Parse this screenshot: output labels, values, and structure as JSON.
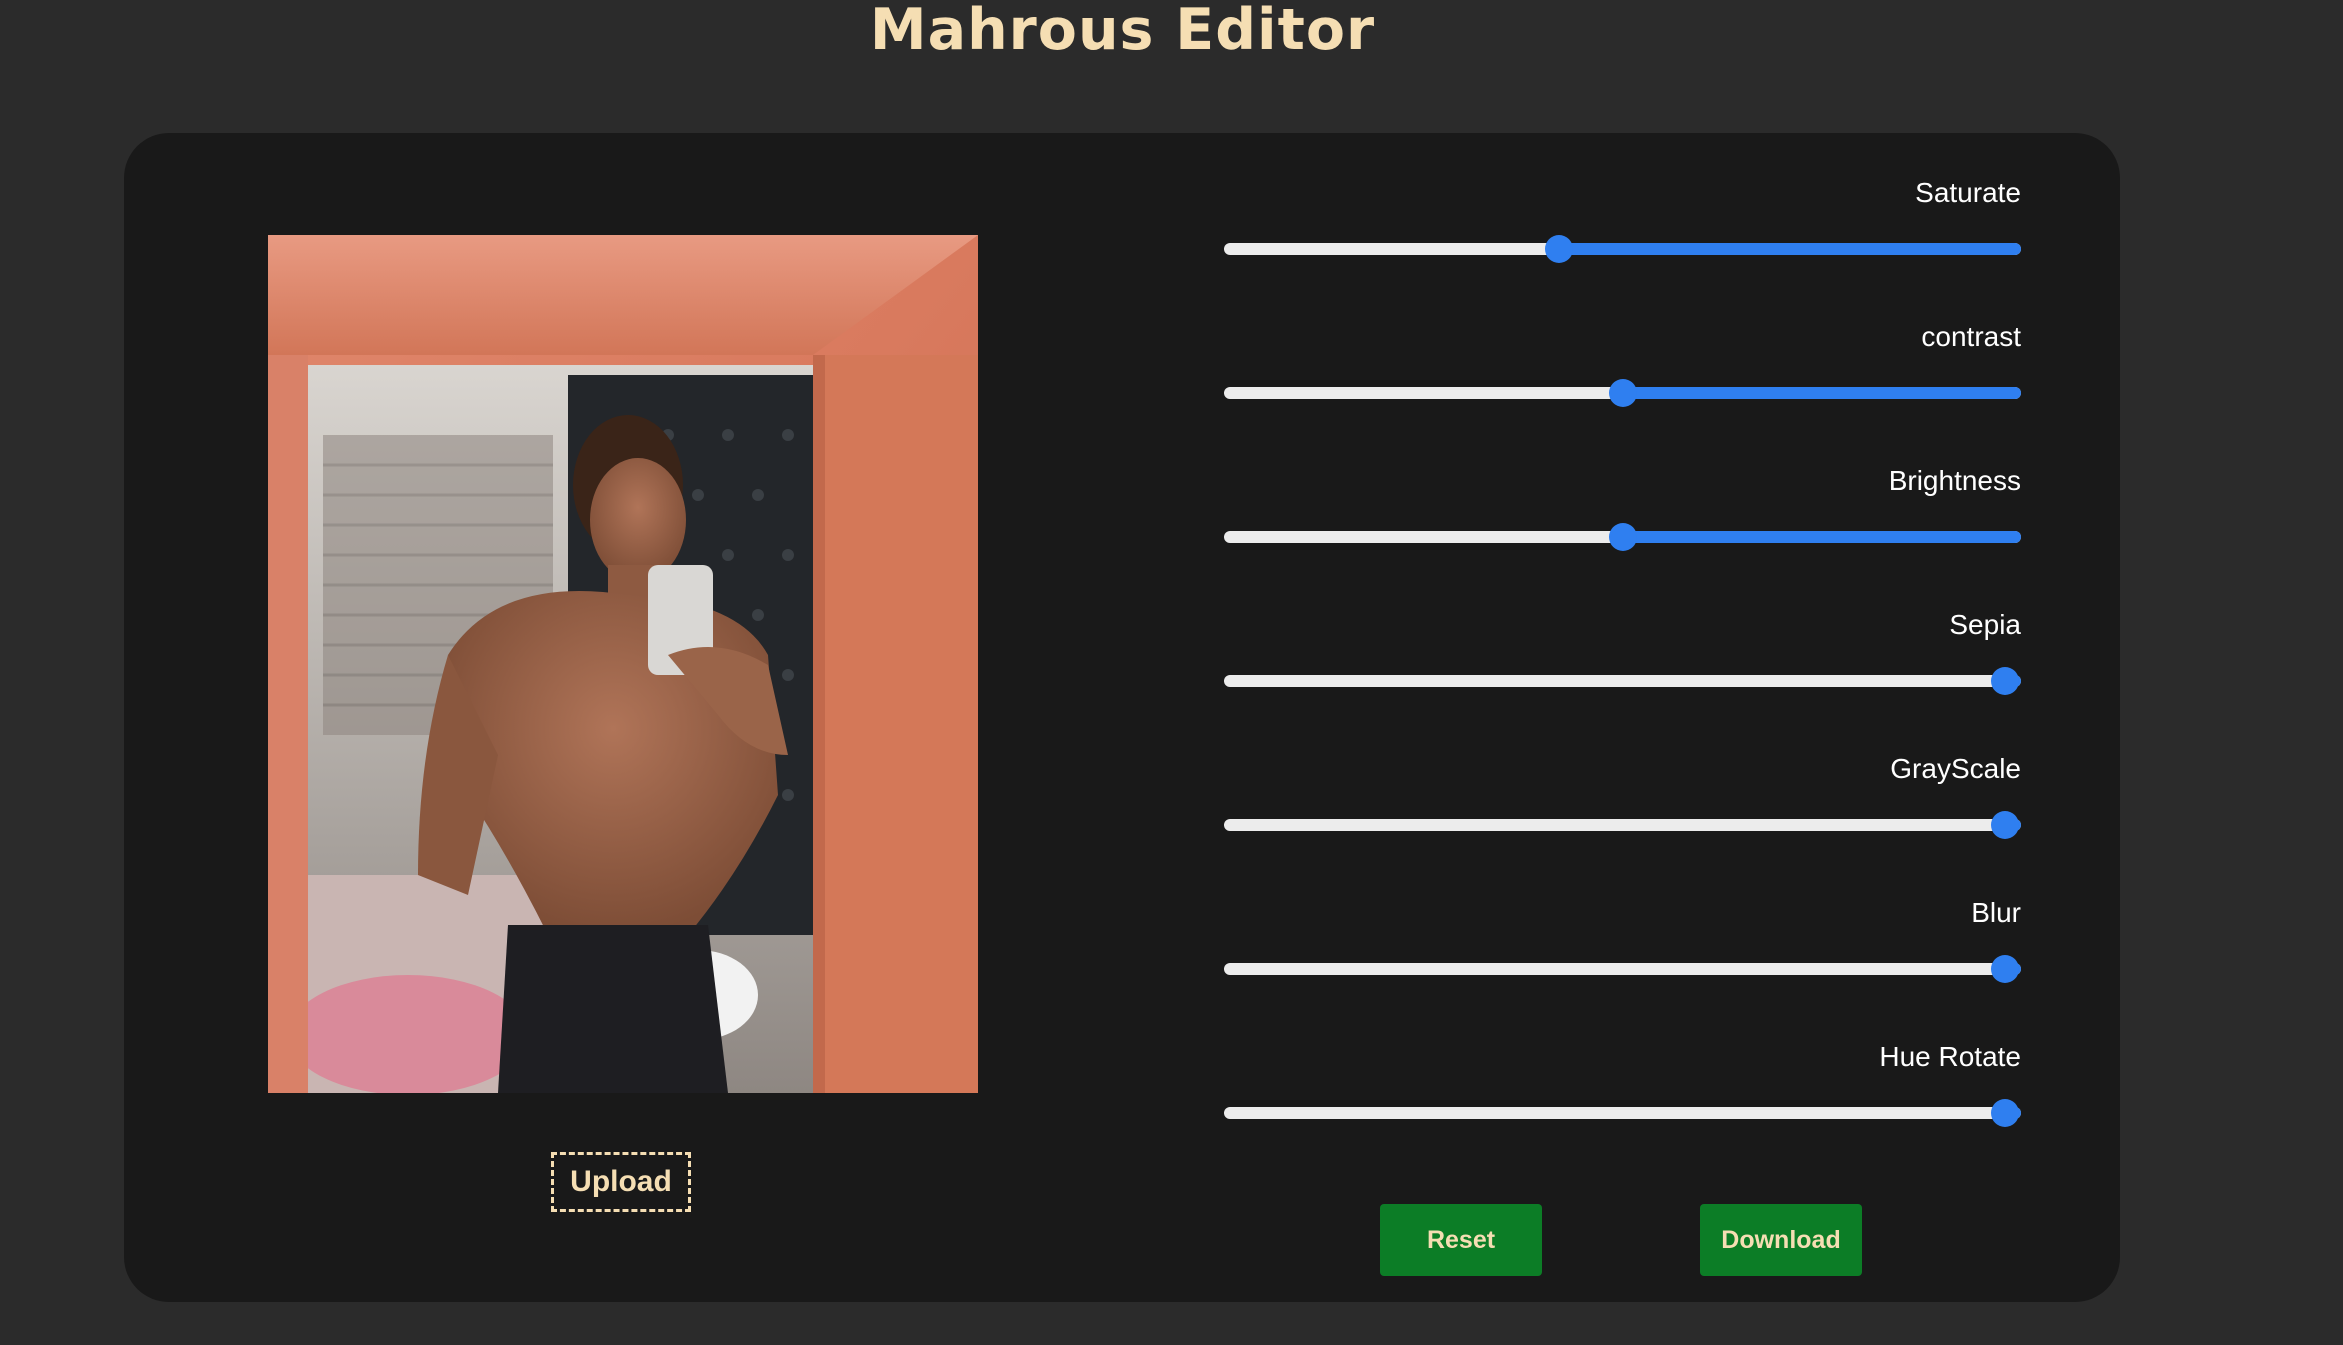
{
  "header": {
    "title": "Mahrous Editor"
  },
  "preview": {
    "image_icon": "photo-preview"
  },
  "upload": {
    "label": "Upload"
  },
  "controls": [
    {
      "label": "Saturate",
      "value": 0.42
    },
    {
      "label": "contrast",
      "value": 0.5
    },
    {
      "label": "Brightness",
      "value": 0.5
    },
    {
      "label": "Sepia",
      "value": 0.98
    },
    {
      "label": "GrayScale",
      "value": 0.98
    },
    {
      "label": "Blur",
      "value": 0.98
    },
    {
      "label": "Hue Rotate",
      "value": 0.98
    }
  ],
  "actions": {
    "reset_label": "Reset",
    "download_label": "Download"
  },
  "colors": {
    "background": "#2b2b2b",
    "card": "#191919",
    "accent_text": "#f5deb3",
    "slider_fill": "#2f7ff0",
    "slider_track": "#ececec",
    "button": "#0c7d26"
  }
}
